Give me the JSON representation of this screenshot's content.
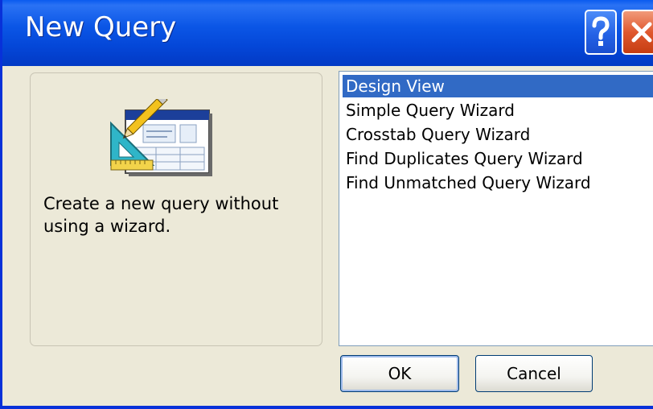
{
  "window": {
    "title": "New Query"
  },
  "titlebar": {
    "help_icon": "question-mark-icon",
    "close_icon": "close-x-icon"
  },
  "preview": {
    "icon": "query-design-icon",
    "description": "Create a new query without using a wizard."
  },
  "options": {
    "items": [
      {
        "label": "Design View",
        "selected": true
      },
      {
        "label": "Simple Query Wizard",
        "selected": false
      },
      {
        "label": "Crosstab Query Wizard",
        "selected": false
      },
      {
        "label": "Find Duplicates Query Wizard",
        "selected": false
      },
      {
        "label": "Find Unmatched Query Wizard",
        "selected": false
      }
    ]
  },
  "buttons": {
    "ok_label": "OK",
    "cancel_label": "Cancel"
  },
  "colors": {
    "titlebar_blue": "#0b56e6",
    "selection_blue": "#316ac5",
    "close_red": "#e0582e",
    "dialog_bg": "#ece9d8"
  }
}
